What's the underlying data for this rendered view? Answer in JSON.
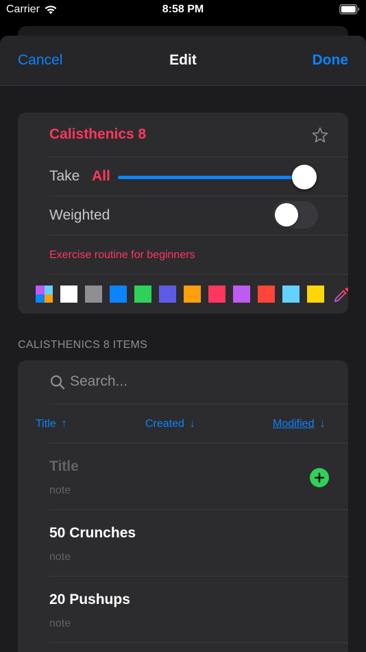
{
  "status_bar": {
    "carrier": "Carrier",
    "time": "8:58 PM"
  },
  "nav": {
    "cancel": "Cancel",
    "title": "Edit",
    "done": "Done"
  },
  "list": {
    "title": "Calisthenics 8",
    "take_label": "Take",
    "take_value": "All",
    "take_slider_fraction": 1.0,
    "weighted_label": "Weighted",
    "weighted_on": false,
    "note": "Exercise routine for beginners"
  },
  "colors": {
    "accent": "#0a84ff",
    "list_color": "#ff375f",
    "swatches": [
      "multi",
      "#ffffff",
      "#8e8e93",
      "#0a84ff",
      "#30d158",
      "#5e5ce6",
      "#ff9f0a",
      "#ff375f",
      "#bf5af2",
      "#ff453a",
      "#64d2ff",
      "#ffd60a"
    ]
  },
  "items_section": {
    "header": "CALISTHENICS 8 ITEMS",
    "search_placeholder": "Search...",
    "sort": {
      "title": "Title",
      "title_dir": "↑",
      "created": "Created",
      "created_dir": "↓",
      "modified": "Modified",
      "modified_dir": "↓"
    },
    "new_item": {
      "title": "Title",
      "note": "note"
    },
    "items": [
      {
        "title": "50 Crunches",
        "note": "note"
      },
      {
        "title": "20 Pushups",
        "note": "note"
      }
    ]
  }
}
